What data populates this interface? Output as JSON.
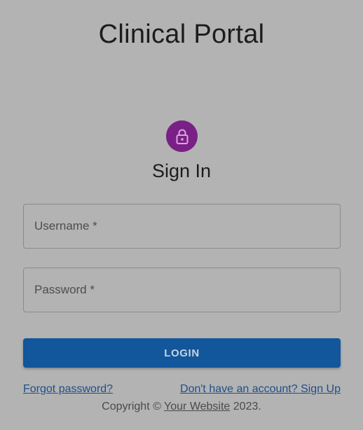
{
  "app": {
    "title": "Clinical Portal"
  },
  "signin": {
    "icon": "lock-icon",
    "avatar_color": "#7a1f86",
    "heading": "Sign In",
    "username_label": "Username *",
    "password_label": "Password *",
    "login_label": "LOGIN",
    "login_color": "#12569c",
    "forgot_label": "Forgot password?",
    "signup_label": "Don't have an account? Sign Up"
  },
  "footer": {
    "prefix": "Copyright © ",
    "site_label": "Your Website",
    "suffix": " 2023."
  }
}
